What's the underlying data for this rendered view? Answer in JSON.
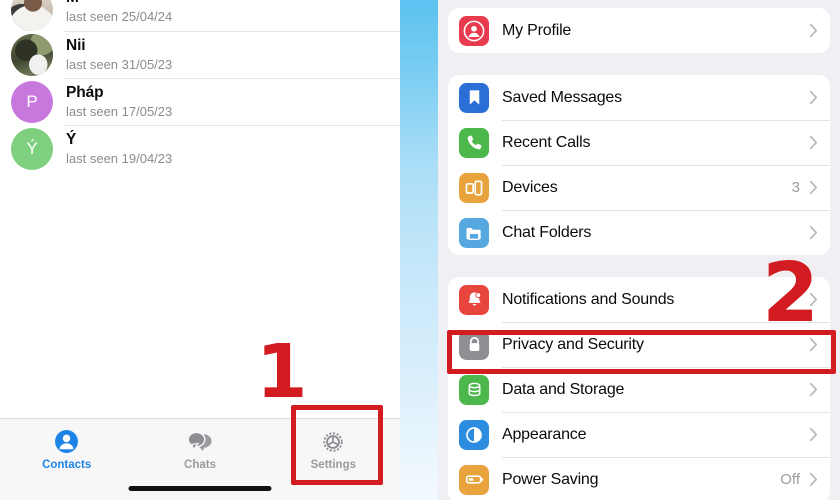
{
  "left_panel": {
    "name": "contacts-screen",
    "contacts": [
      {
        "name": "M",
        "status": "last seen 25/04/24",
        "avatar_type": "photo-a",
        "initial": ""
      },
      {
        "name": "Nii",
        "status": "last seen 31/05/23",
        "avatar_type": "photo-b",
        "initial": ""
      },
      {
        "name": "Pháp",
        "status": "last seen 17/05/23",
        "avatar_type": "letter",
        "initial": "P",
        "avatar_color": "#c878dd"
      },
      {
        "name": "Ý",
        "status": "last seen 19/04/23",
        "avatar_type": "letter",
        "initial": "Ý",
        "avatar_color": "#7ed080"
      }
    ],
    "tabs": [
      {
        "label": "Contacts",
        "icon": "contacts-icon",
        "active": true
      },
      {
        "label": "Chats",
        "icon": "chats-icon",
        "active": false
      },
      {
        "label": "Settings",
        "icon": "settings-gear-icon",
        "active": false
      }
    ],
    "active_tab_color": "#1f84e8",
    "inactive_tab_color": "#9a9aa0"
  },
  "right_panel": {
    "name": "settings-screen",
    "groups": [
      {
        "rows": [
          {
            "label": "My Profile",
            "value": "",
            "icon": "profile-icon",
            "icon_color": "#e83b4e"
          }
        ]
      },
      {
        "rows": [
          {
            "label": "Saved Messages",
            "value": "",
            "icon": "bookmark-icon",
            "icon_color": "#2b6fd6"
          },
          {
            "label": "Recent Calls",
            "value": "",
            "icon": "phone-icon",
            "icon_color": "#4cb84c"
          },
          {
            "label": "Devices",
            "value": "3",
            "icon": "devices-icon",
            "icon_color": "#e8a33d"
          },
          {
            "label": "Chat Folders",
            "value": "",
            "icon": "folder-icon",
            "icon_color": "#56a9e0"
          }
        ]
      },
      {
        "rows": [
          {
            "label": "Notifications and Sounds",
            "value": "",
            "icon": "bell-icon",
            "icon_color": "#e8453c"
          },
          {
            "label": "Privacy and Security",
            "value": "",
            "icon": "lock-icon",
            "icon_color": "#8e8e93"
          },
          {
            "label": "Data and Storage",
            "value": "",
            "icon": "database-icon",
            "icon_color": "#4cb84c"
          },
          {
            "label": "Appearance",
            "value": "",
            "icon": "contrast-icon",
            "icon_color": "#2b8ce0"
          },
          {
            "label": "Power Saving",
            "value": "Off",
            "icon": "battery-icon",
            "icon_color": "#e8a33d"
          }
        ]
      }
    ]
  },
  "annotations": {
    "color": "#d31b22",
    "step_one_label": "1",
    "step_two_label": "2",
    "highlight_settings_tab": "settings-tab-highlight",
    "highlight_privacy_row": "privacy-and-security-highlight"
  },
  "divider": {
    "top_color": "#5cc2ef",
    "bottom_color": "#f3f9fe"
  }
}
